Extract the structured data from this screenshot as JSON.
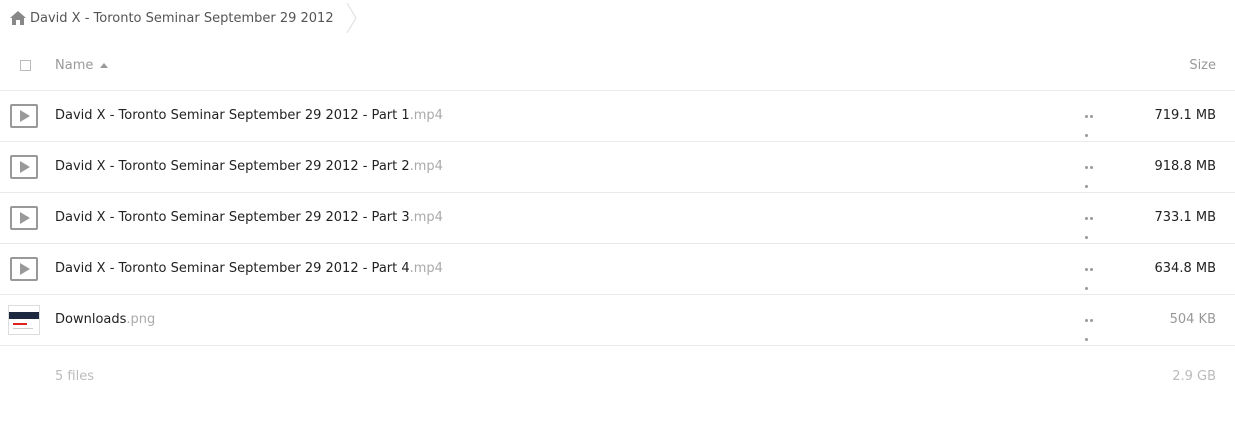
{
  "breadcrumb": {
    "icon": "home-icon",
    "folder": "David X - Toronto Seminar September 29 2012"
  },
  "header": {
    "name_label": "Name",
    "size_label": "Size",
    "sort_icon": "sort-ascending-icon"
  },
  "files": [
    {
      "base": "David X - Toronto Seminar September 29 2012 - Part 1",
      "ext": ".mp4",
      "size": "719.1 MB",
      "icon": "video-play-icon"
    },
    {
      "base": "David X - Toronto Seminar September 29 2012 - Part 2",
      "ext": ".mp4",
      "size": "918.8 MB",
      "icon": "video-play-icon"
    },
    {
      "base": "David X - Toronto Seminar September 29 2012 - Part 3",
      "ext": ".mp4",
      "size": "733.1 MB",
      "icon": "video-play-icon"
    },
    {
      "base": "David X - Toronto Seminar September 29 2012 - Part 4",
      "ext": ".mp4",
      "size": "634.8 MB",
      "icon": "video-play-icon"
    },
    {
      "base": "Downloads",
      "ext": ".png",
      "size": "504 KB",
      "icon": "image-thumbnail"
    }
  ],
  "summary": {
    "files_count": "5 files",
    "total_size": "2.9 GB"
  },
  "colors": {
    "border": "#e9e9e9",
    "muted_text": "#999999",
    "icon_gray": "#999999"
  }
}
